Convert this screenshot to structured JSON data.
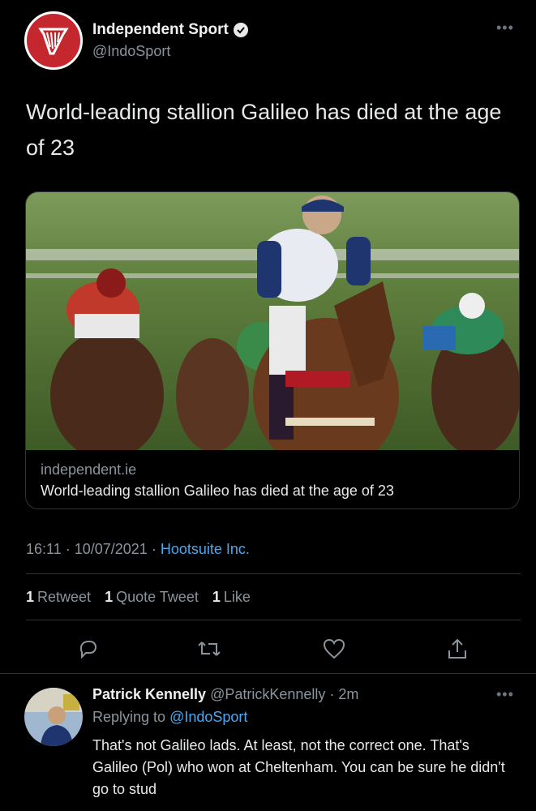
{
  "author": {
    "name": "Independent Sport",
    "handle": "@IndoSport"
  },
  "tweet": {
    "text": "World-leading stallion Galileo has died at the age of 23"
  },
  "card": {
    "domain": "independent.ie",
    "title": "World-leading stallion Galileo has died at the age of 23"
  },
  "meta": {
    "time": "16:11",
    "date": "10/07/2021",
    "source": "Hootsuite Inc."
  },
  "stats": {
    "retweets_count": "1",
    "retweets_label": "Retweet",
    "quotes_count": "1",
    "quotes_label": "Quote Tweet",
    "likes_count": "1",
    "likes_label": "Like"
  },
  "actions": [
    "reply-icon",
    "retweet-icon",
    "like-icon",
    "share-icon"
  ],
  "reply": {
    "name": "Patrick Kennelly",
    "handle": "@PatrickKennelly",
    "time": "2m",
    "replying_prefix": "Replying to",
    "replying_to": "@IndoSport",
    "text": "That's not Galileo lads. At least, not the correct one. That's Galileo (Pol) who won at Cheltenham. You can be sure he didn't go to stud"
  },
  "colors": {
    "background": "#000000",
    "link": "#4ea6ee",
    "secondary_text": "#8b949c",
    "brand_red": "#c4272d"
  }
}
